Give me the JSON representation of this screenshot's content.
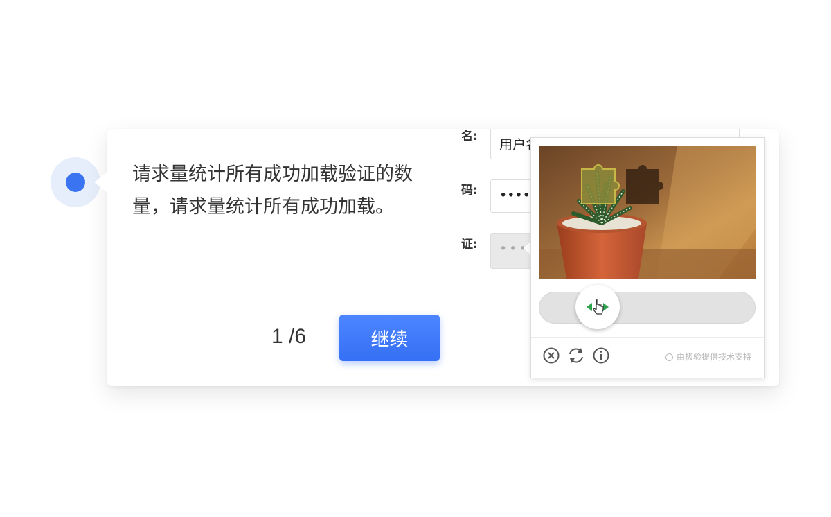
{
  "guide": {
    "description": "请求量统计所有成功加载验证的数量，请求量统计所有成功加载。",
    "step": "1 /6",
    "continue_label": "继续"
  },
  "login_form": {
    "username_label": "名:",
    "username_value": "用户名",
    "password_label": "码:",
    "password_value": "•••••",
    "verify_label": "证:",
    "verify_value": "•••"
  },
  "captcha": {
    "powered_by": "由极验提供技术支持",
    "icons": [
      "close-circle-icon",
      "refresh-icon",
      "info-icon"
    ]
  },
  "colors": {
    "accent": "#3a74f0",
    "button": "#4077f7"
  }
}
